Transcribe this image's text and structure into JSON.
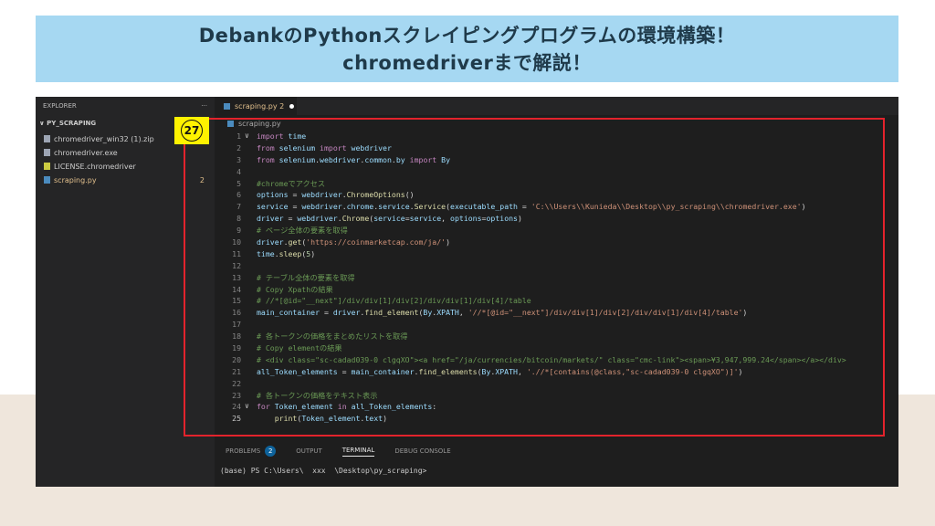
{
  "banner": {
    "line1": "DebankのPythonスクレイピングプログラムの環境構築！",
    "line2": "chromedriverまで解説！"
  },
  "explorer": {
    "title": "EXPLORER",
    "more": "···",
    "folder": "PY_SCRAPING",
    "files": [
      {
        "name": "chromedriver_win32 (1).zip",
        "icon": "zip-icon",
        "badge": "",
        "active": false
      },
      {
        "name": "chromedriver.exe",
        "icon": "file-icon",
        "badge": "",
        "active": false
      },
      {
        "name": "LICENSE.chromedriver",
        "icon": "license-icon",
        "badge": "",
        "active": false
      },
      {
        "name": "scraping.py",
        "icon": "python-icon",
        "badge": "2",
        "active": true
      }
    ]
  },
  "tab": {
    "label": "scraping.py",
    "count": "2"
  },
  "breadcrumb": "scraping.py",
  "marker": "27",
  "code": [
    {
      "n": "1",
      "fold": "∨",
      "t": "import time"
    },
    {
      "n": "2",
      "fold": "",
      "t": "from selenium import webdriver"
    },
    {
      "n": "3",
      "fold": "",
      "t": "from selenium.webdriver.common.by import By"
    },
    {
      "n": "4",
      "fold": "",
      "t": ""
    },
    {
      "n": "5",
      "fold": "",
      "t": "#chromeでアクセス"
    },
    {
      "n": "6",
      "fold": "",
      "t": "options = webdriver.ChromeOptions()"
    },
    {
      "n": "7",
      "fold": "",
      "t": "service = webdriver.chrome.service.Service(executable_path = 'C:\\\\Users\\\\Kunieda\\\\Desktop\\\\py_scraping\\\\chromedriver.exe')"
    },
    {
      "n": "8",
      "fold": "",
      "t": "driver = webdriver.Chrome(service=service, options=options)"
    },
    {
      "n": "9",
      "fold": "",
      "t": "# ページ全体の要素を取得"
    },
    {
      "n": "10",
      "fold": "",
      "t": "driver.get('https://coinmarketcap.com/ja/')"
    },
    {
      "n": "11",
      "fold": "",
      "t": "time.sleep(5)"
    },
    {
      "n": "12",
      "fold": "",
      "t": ""
    },
    {
      "n": "13",
      "fold": "",
      "t": "# テーブル全体の要素を取得"
    },
    {
      "n": "14",
      "fold": "",
      "t": "# Copy Xpathの結果"
    },
    {
      "n": "15",
      "fold": "",
      "t": "# //*[@id=\"__next\"]/div/div[1]/div[2]/div/div[1]/div[4]/table"
    },
    {
      "n": "16",
      "fold": "",
      "t": "main_container = driver.find_element(By.XPATH, '//*[@id=\"__next\"]/div/div[1]/div[2]/div/div[1]/div[4]/table')"
    },
    {
      "n": "17",
      "fold": "",
      "t": ""
    },
    {
      "n": "18",
      "fold": "",
      "t": "# 各トークンの価格をまとめたリストを取得"
    },
    {
      "n": "19",
      "fold": "",
      "t": "# Copy elementの結果"
    },
    {
      "n": "20",
      "fold": "",
      "t": "# <div class=\"sc-cadad039-0 clgqXO\"><a href=\"/ja/currencies/bitcoin/markets/\" class=\"cmc-link\"><span>¥3,947,999.24</span></a></div>"
    },
    {
      "n": "21",
      "fold": "",
      "t": "all_Token_elements = main_container.find_elements(By.XPATH, './/*[contains(@class,\"sc-cadad039-0 clgqXO\")]')"
    },
    {
      "n": "22",
      "fold": "",
      "t": ""
    },
    {
      "n": "23",
      "fold": "",
      "t": "# 各トークンの価格をテキスト表示"
    },
    {
      "n": "24",
      "fold": "∨",
      "t": "for Token_element in all_Token_elements:"
    },
    {
      "n": "25",
      "fold": "",
      "t": "    print(Token_element.text)"
    }
  ],
  "panel": {
    "problems": "PROBLEMS",
    "problems_count": "2",
    "output": "OUTPUT",
    "terminal": "TERMINAL",
    "debug": "DEBUG CONSOLE"
  },
  "terminal_line": "(base) PS C:\\Users\\  xxx  \\Desktop\\py_scraping>"
}
